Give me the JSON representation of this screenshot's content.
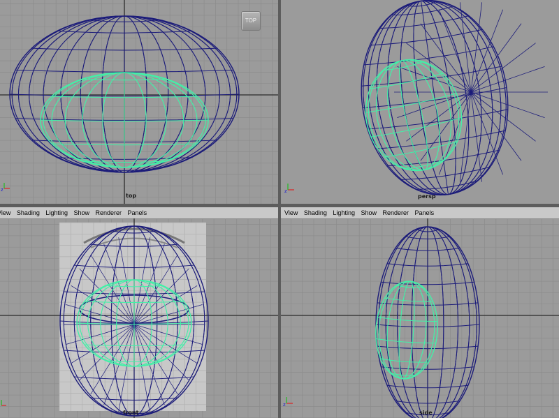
{
  "viewports": {
    "top": {
      "camera": "top",
      "view_cube": "TOP"
    },
    "persp": {
      "camera": "persp"
    },
    "front": {
      "camera": "front"
    },
    "side": {
      "camera": "side"
    }
  },
  "menu": {
    "front": [
      "View",
      "Shading",
      "Lighting",
      "Show",
      "Renderer",
      "Panels"
    ],
    "side": [
      "View",
      "Shading",
      "Lighting",
      "Show",
      "Renderer",
      "Panels"
    ]
  },
  "colors": {
    "viewport_bg": "#9b9b9b",
    "grid": "#8c8c8c",
    "axis": "#2b2b2b",
    "wire": "#1c1c7a",
    "selected_wire": "#43f0a8",
    "menubar": "#c9c9c9"
  },
  "icons": [
    "axis-gizmo-icon",
    "view-cube-icon"
  ]
}
